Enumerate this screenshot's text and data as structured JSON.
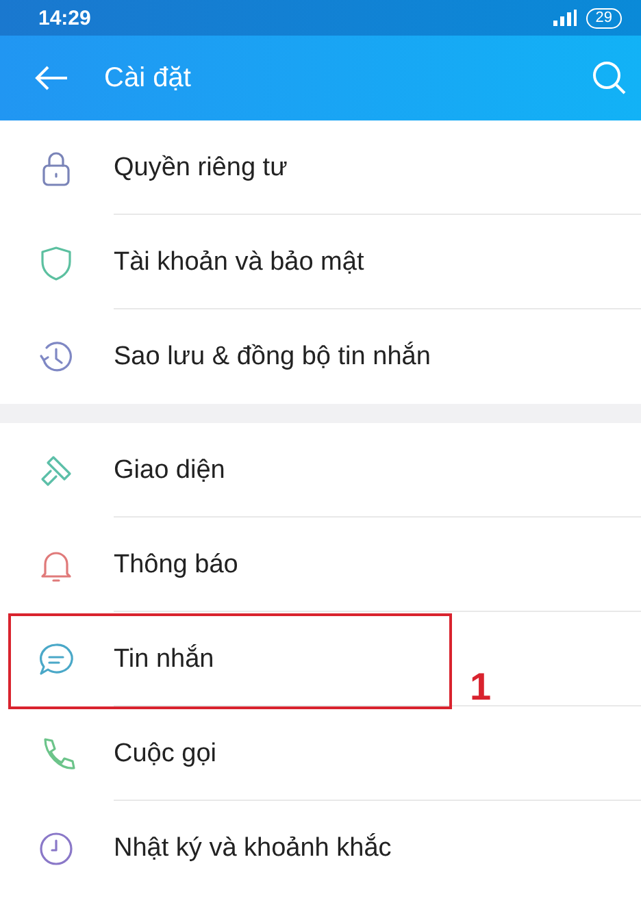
{
  "status_bar": {
    "time": "14:29",
    "battery": "29"
  },
  "header": {
    "title": "Cài đặt"
  },
  "groups": [
    {
      "items": [
        {
          "label": "Quyền riêng tư",
          "kind": "lock",
          "color": "#7a84b8",
          "highlighted": false
        },
        {
          "label": "Tài khoản và bảo mật",
          "kind": "shield",
          "color": "#5cc0a0",
          "highlighted": false
        },
        {
          "label": "Sao lưu & đồng bộ tin nhắn",
          "kind": "history",
          "color": "#7f88c4",
          "highlighted": false
        }
      ]
    },
    {
      "items": [
        {
          "label": "Giao diện",
          "kind": "brush",
          "color": "#5cbfa8",
          "highlighted": false
        },
        {
          "label": "Thông báo",
          "kind": "bell",
          "color": "#e07a7a",
          "highlighted": false
        },
        {
          "label": "Tin nhắn",
          "kind": "chat",
          "color": "#4aa8c8",
          "highlighted": true,
          "annotation": "1"
        },
        {
          "label": "Cuộc gọi",
          "kind": "phone",
          "color": "#6cc48a",
          "highlighted": false
        },
        {
          "label": "Nhật ký và khoảnh khắc",
          "kind": "clock",
          "color": "#8a78c8",
          "highlighted": false
        }
      ]
    }
  ]
}
